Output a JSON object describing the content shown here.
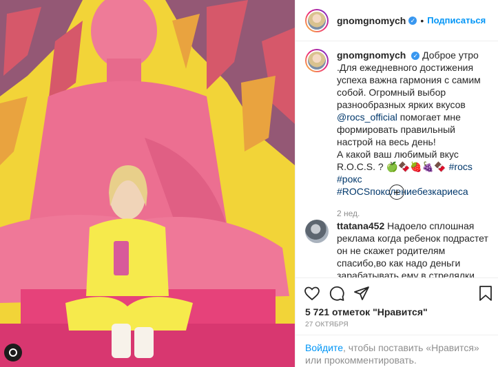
{
  "header": {
    "username": "gnomgnomych",
    "separator": "•",
    "follow_label": "Подписаться",
    "verified_mark": "✓"
  },
  "caption": {
    "username": "gnomgnomych",
    "line1": "Доброе утро .Для ежедневного достижения успеха важна гармония с самим собой. Огромный выбор разнообразных ярких вкусов",
    "mention": "@rocs_official",
    "line2": "помогает мне формировать правильный настрой на весь день!",
    "line3": "А какой ваш любимый вкус R.O.C.S. ? 🍏🍫🍓🍇🍫",
    "tag1": "#rocs",
    "tag2": "#рокс",
    "tag3": "#ROCSпоколениебезкариеса",
    "time": "2 нед."
  },
  "load_more_symbol": "+",
  "comment": {
    "username": "ttatana452",
    "text": "Надоело сплошная реклама когда ребенок подрастет он не скажет родителям спасибо,во как надо деньги зарабатывать,ему в стрелялки играть нужно а не деньги"
  },
  "likes": {
    "count": "5 721",
    "label_before": "отметок",
    "label_quote": "\"Нравится\""
  },
  "date": "27 ОКТЯБРЯ",
  "login": {
    "signin": "Войдите",
    "rest": ", чтобы поставить «Нравится» или прокомментировать."
  },
  "icons": {
    "like": "heart-icon",
    "comment": "comment-icon",
    "share": "share-icon",
    "save": "bookmark-icon"
  },
  "colors": {
    "accent": "#0095f6",
    "verified": "#3897f0",
    "photo_bg": "#f4d53a",
    "statue": "#ec6f91",
    "sweatsuit": "#f6ea4c"
  }
}
